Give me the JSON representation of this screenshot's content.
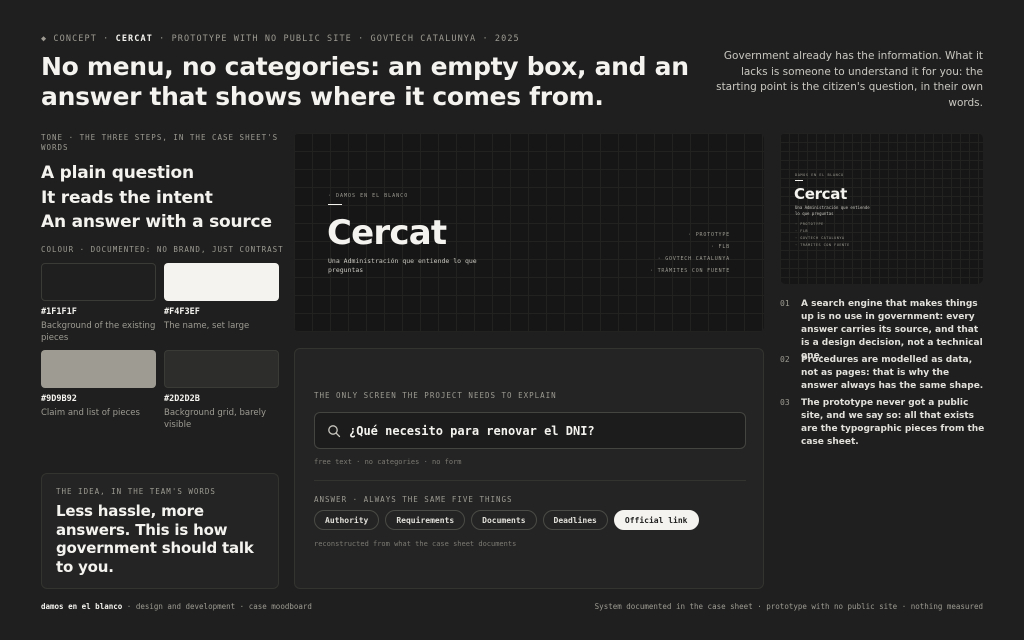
{
  "header": {
    "eyebrow_pre": "◆ CONCEPT · ",
    "eyebrow_brand": "CERCAT",
    "eyebrow_post": " · PROTOTYPE WITH NO PUBLIC SITE · GOVTECH CATALUNYA · 2025",
    "headline": "No menu, no categories: an empty box, and an answer that shows where it comes from.",
    "intro": "Government already has the information. What it lacks is someone to understand it for you: the starting point is the citizen's question, in their own words."
  },
  "tone": {
    "label": "TONE · THE THREE STEPS, IN THE CASE SHEET'S WORDS",
    "steps": [
      "A plain question",
      "It reads the intent",
      "An answer with a source"
    ]
  },
  "colour": {
    "label": "COLOUR · DOCUMENTED: NO BRAND, JUST CONTRAST",
    "swatches": [
      {
        "hex": "#1F1F1F",
        "desc": "Background of the existing pieces",
        "color": "#1f1f1f"
      },
      {
        "hex": "#F4F3EF",
        "desc": "The name, set large",
        "color": "#f4f3ef"
      },
      {
        "hex": "#9D9B92",
        "desc": "Claim and list of pieces",
        "color": "#9d9b92"
      },
      {
        "hex": "#2D2D2B",
        "desc": "Background grid, barely visible",
        "color": "#2d2d2b"
      }
    ]
  },
  "idea": {
    "label": "THE IDEA, IN THE TEAM'S WORDS",
    "text": "Less hassle, more answers. This is how government should talk to you."
  },
  "hero": {
    "kicker": "· DAMOS EN EL BLANCO",
    "title": "Cercat",
    "subtitle": "Una Administración que entiende lo que preguntas",
    "list": [
      "· PROTOTYPE",
      "· FLB",
      "· GOVTECH CATALUNYA",
      "· TRÁMITES CON FUENTE"
    ]
  },
  "thumb": {
    "kicker": "DAMOS EN EL BLANCO",
    "title": "Cercat",
    "subtitle": "Una Administración que entiende lo que preguntas",
    "list": [
      "· PROTOTYPE",
      "· FLB",
      "· GOVTECH CATALUNYA",
      "· TRÁMITES CON FUENTE"
    ]
  },
  "notes": [
    {
      "num": "01",
      "text": "A search engine that makes things up is no use in government: every answer carries its source, and that is a design decision, not a technical one."
    },
    {
      "num": "02",
      "text": "Procedures are modelled as data, not as pages: that is why the answer always has the same shape."
    },
    {
      "num": "03",
      "text": "The prototype never got a public site, and we say so: all that exists are the typographic pieces from the case sheet."
    }
  ],
  "explain": {
    "label": "THE ONLY SCREEN THE PROJECT NEEDS TO EXPLAIN",
    "query": "¿Qué necesito para renovar el DNI?",
    "hint": "free text · no categories · no form",
    "answer_label": "ANSWER · ALWAYS THE SAME FIVE THINGS",
    "pills": [
      "Authority",
      "Requirements",
      "Documents",
      "Deadlines",
      "Official link"
    ],
    "recon": "reconstructed from what the case sheet documents"
  },
  "footer": {
    "brand": "damos en el blanco",
    "left_rest": " · design and development · case moodboard",
    "right": "System documented in the case sheet · prototype with no public site · nothing measured"
  }
}
